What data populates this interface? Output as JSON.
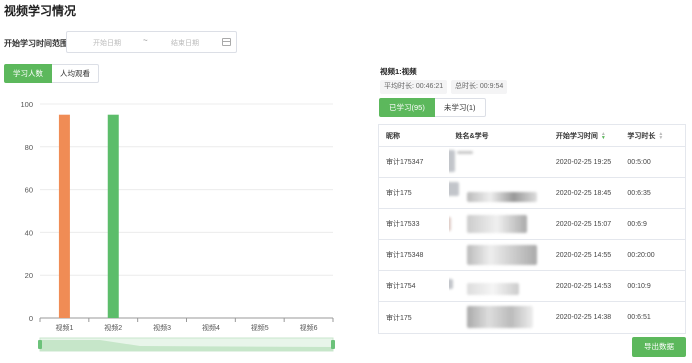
{
  "page": {
    "title": "视频学习情况"
  },
  "filter": {
    "range_label": "开始学习时间范围",
    "start_placeholder": "开始日期",
    "separator": "~",
    "end_placeholder": "结束日期",
    "calendar_icon": "calendar-icon"
  },
  "left_tabs": [
    "学习人数",
    "人均观看"
  ],
  "chart_data": {
    "type": "bar",
    "categories": [
      "视频1",
      "视频2",
      "视频3",
      "视频4",
      "视频5",
      "视频6"
    ],
    "values": [
      95,
      95,
      0,
      0,
      0,
      0
    ],
    "bar_colors": [
      "#f08c55",
      "#5cbd6a",
      "#5cbd6a",
      "#5cbd6a",
      "#5cbd6a",
      "#5cbd6a"
    ],
    "ylim": [
      0,
      100
    ],
    "yticks": [
      0,
      20,
      40,
      60,
      80,
      100
    ],
    "grid": true,
    "xlabel": "",
    "ylabel": "",
    "datazoom_slider": true
  },
  "detail": {
    "title": "视频1:视频",
    "avg_duration": "平均时长: 00:46:21",
    "total_duration": "总时长: 00:9:54",
    "tabs": [
      "已学习(95)",
      "未学习(1)"
    ],
    "columns": [
      "昵称",
      "姓名&学号",
      "开始学习时间",
      "学习时长"
    ],
    "rows": [
      {
        "nickname": "审计175347",
        "start": "2020-02-25 19:25",
        "duration": "00:5:00"
      },
      {
        "nickname": "审计175",
        "start": "2020-02-25 18:45",
        "duration": "00:6:35"
      },
      {
        "nickname": "审计17533",
        "start": "2020-02-25 15:07",
        "duration": "00:6:9"
      },
      {
        "nickname": "审计175348",
        "start": "2020-02-25 14:55",
        "duration": "00:20:00"
      },
      {
        "nickname": "审计1754",
        "start": "2020-02-25 14:53",
        "duration": "00:10:9"
      },
      {
        "nickname": "审计175",
        "start": "2020-02-25 14:38",
        "duration": "00:6:51"
      }
    ],
    "export_label": "导出数据"
  }
}
